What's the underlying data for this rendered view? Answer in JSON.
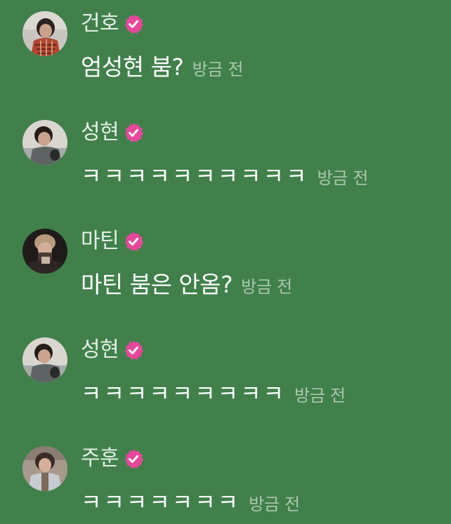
{
  "colors": {
    "background": "#41804b",
    "badge": "#e8479c",
    "timestamp": "#a9c8ae"
  },
  "icons": {
    "badge": "verified-badge-icon"
  },
  "messages": [
    {
      "author": "건호",
      "text": "엄성현 붐?",
      "time": "방금 전"
    },
    {
      "author": "성현",
      "text": "ㅋㅋㅋㅋㅋㅋㅋㅋㅋㅋ",
      "time": "방금 전"
    },
    {
      "author": "마틴",
      "text": "마틴 붐은 안옴?",
      "time": "방금 전"
    },
    {
      "author": "성현",
      "text": "ㅋㅋㅋㅋㅋㅋㅋㅋㅋ",
      "time": "방금 전"
    },
    {
      "author": "주훈",
      "text": "ㅋㅋㅋㅋㅋㅋㅋ",
      "time": "방금 전"
    }
  ]
}
